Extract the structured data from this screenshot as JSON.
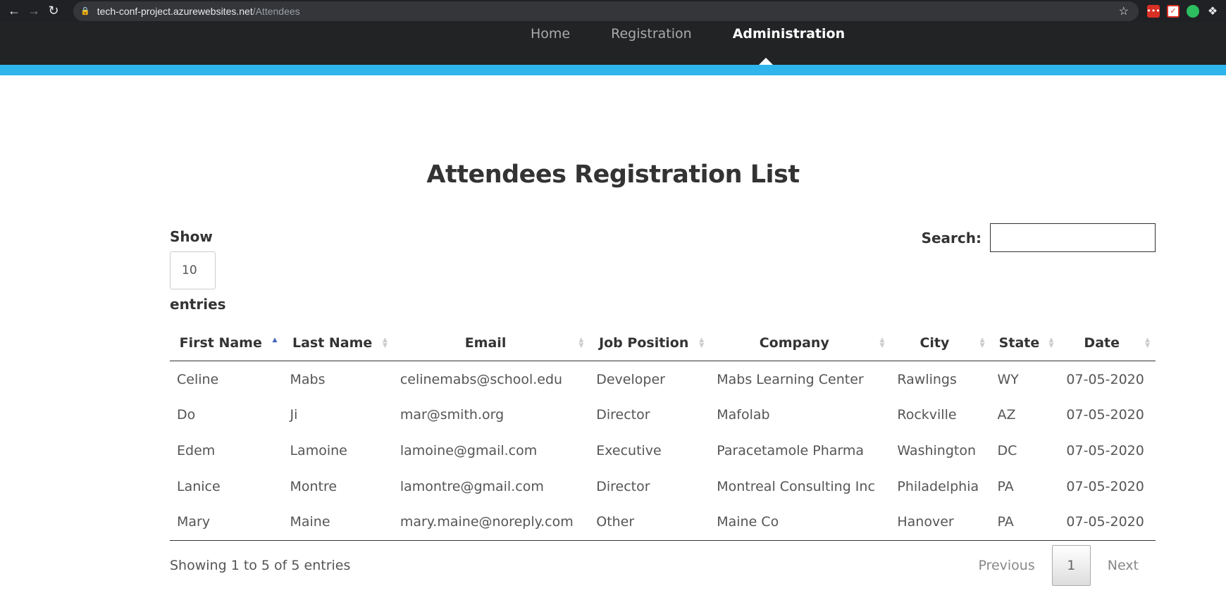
{
  "browser": {
    "url_host": "tech-conf-project.azurewebsites.net",
    "url_path": "/Attendees"
  },
  "nav": {
    "items": [
      "Home",
      "Registration",
      "Administration"
    ],
    "active": "Administration"
  },
  "page": {
    "title": "Attendees Registration List"
  },
  "length": {
    "show_label": "Show",
    "value": "10",
    "entries_label": "entries"
  },
  "search": {
    "label": "Search:",
    "value": ""
  },
  "table": {
    "columns": [
      "First Name",
      "Last Name",
      "Email",
      "Job Position",
      "Company",
      "City",
      "State",
      "Date"
    ],
    "sorted_column": "First Name",
    "sort_direction": "ascending",
    "rows": [
      [
        "Celine",
        "Mabs",
        "celinemabs@school.edu",
        "Developer",
        "Mabs Learning Center",
        "Rawlings",
        "WY",
        "07-05-2020"
      ],
      [
        "Do",
        "Ji",
        "mar@smith.org",
        "Director",
        "Mafolab",
        "Rockville",
        "AZ",
        "07-05-2020"
      ],
      [
        "Edem",
        "Lamoine",
        "lamoine@gmail.com",
        "Executive",
        "Paracetamole Pharma",
        "Washington",
        "DC",
        "07-05-2020"
      ],
      [
        "Lanice",
        "Montre",
        "lamontre@gmail.com",
        "Director",
        "Montreal Consulting Inc",
        "Philadelphia",
        "PA",
        "07-05-2020"
      ],
      [
        "Mary",
        "Maine",
        "mary.maine@noreply.com",
        "Other",
        "Maine Co",
        "Hanover",
        "PA",
        "07-05-2020"
      ]
    ]
  },
  "footer": {
    "info": "Showing 1 to 5 of 5 entries",
    "previous": "Previous",
    "page": "1",
    "next": "Next"
  },
  "colors": {
    "accent": "#2fb4ec",
    "nav_bg": "#222324",
    "sort_active": "#4565ba"
  }
}
